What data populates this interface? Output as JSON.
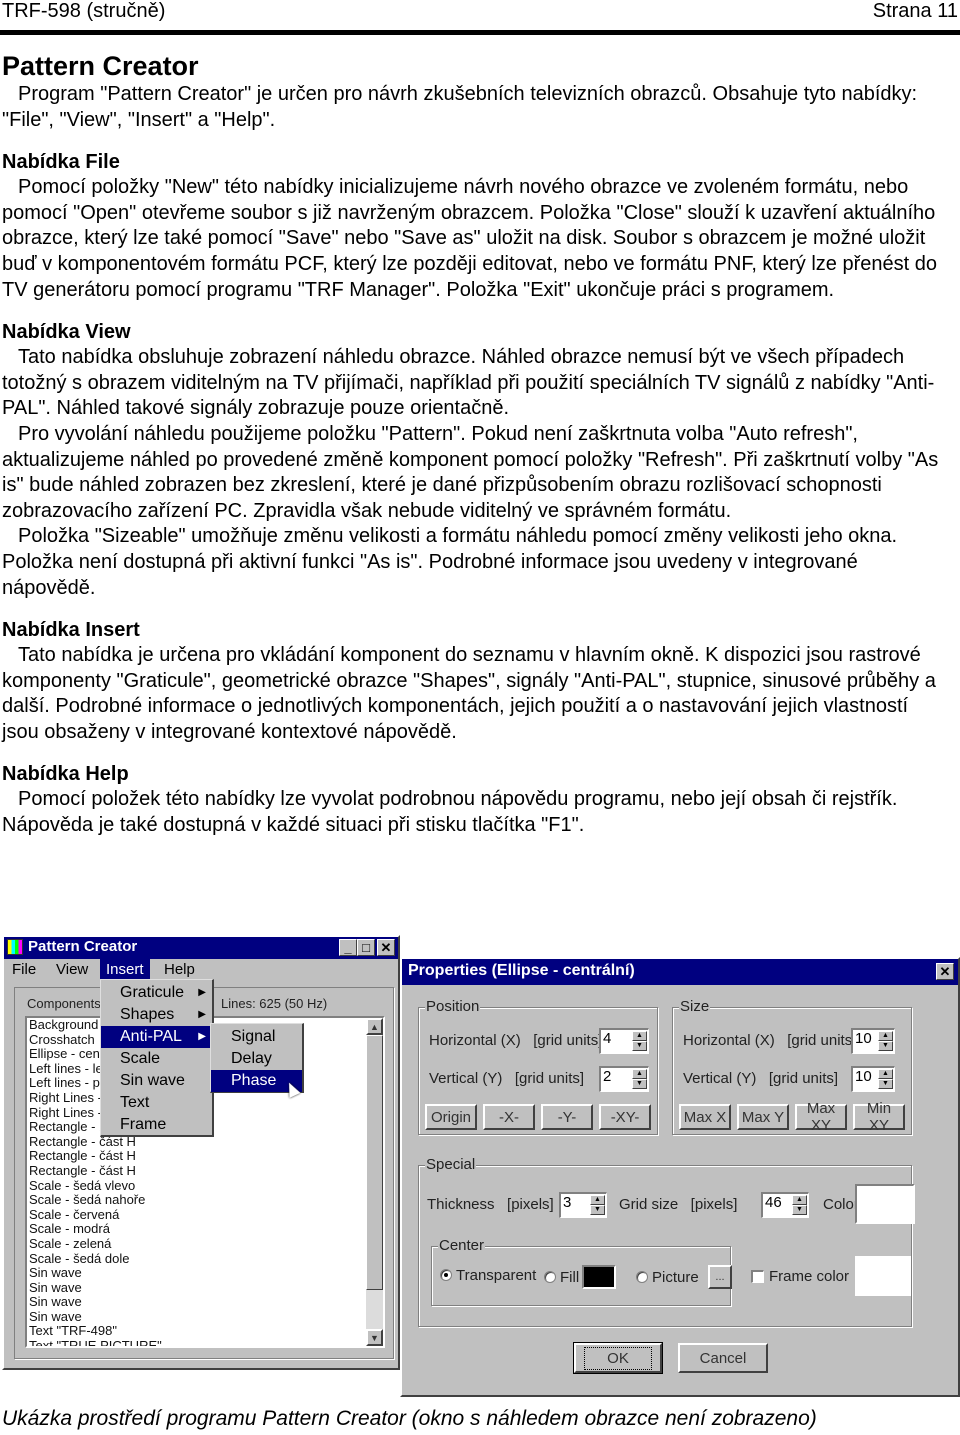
{
  "header": {
    "doc_id": "TRF-598 (stručně)",
    "page": "Strana 11"
  },
  "document": {
    "title": "Pattern Creator",
    "intro": "Program \"Pattern Creator\" je určen pro návrh zkušebních televizních obrazců. Obsahuje tyto nabídky: \"File\", \"View\", \"Insert\" a \"Help\".",
    "sections": [
      {
        "heading": "Nabídka File",
        "paragraphs": [
          "Pomocí položky \"New\" této nabídky inicializujeme návrh nového obrazce ve zvoleném formátu, nebo pomocí \"Open\" otevřeme soubor s již navrženým obrazcem. Položka \"Close\" slouží k uzavření aktuálního obrazce, který lze také pomocí \"Save\" nebo \"Save as\" uložit na disk. Soubor s obrazcem je možné uložit buď v komponentovém formátu PCF, který lze později editovat, nebo ve formátu PNF, který lze přenést do TV generátoru pomocí programu \"TRF Manager\". Položka \"Exit\" ukončuje práci s programem."
        ]
      },
      {
        "heading": "Nabídka View",
        "paragraphs": [
          "Tato nabídka obsluhuje zobrazení náhledu obrazce. Náhled obrazce nemusí být ve všech případech totožný s obrazem viditelným na TV přijímači, například při použití speciálních TV signálů z nabídky \"Anti-PAL\". Náhled takové signály zobrazuje pouze orientačně.",
          "Pro vyvolání náhledu použijeme položku \"Pattern\". Pokud není zaškrtnuta volba \"Auto refresh\", aktualizujeme náhled po provedené změně komponent pomocí položky \"Refresh\". Při zaškrtnutí volby \"As is\" bude náhled zobrazen bez zkreslení, které je dané přizpůsobením obrazu rozlišovací schopnosti zobrazovacího zařízení PC. Zpravidla však nebude viditelný ve správném formátu.",
          "Položka \"Sizeable\" umožňuje změnu velikosti a formátu náhledu pomocí změny velikosti jeho okna. Položka není dostupná při aktivní funkci \"As is\". Podrobné informace jsou uvedeny v integrované nápovědě."
        ]
      },
      {
        "heading": "Nabídka Insert",
        "paragraphs": [
          "Tato nabídka je určena pro vkládání komponent do seznamu v hlavním okně. K dispozici jsou rastrové komponenty \"Graticule\", geometrické obrazce \"Shapes\", signály \"Anti-PAL\", stupnice, sinusové průběhy a další. Podrobné informace o jednotlivých komponentách, jejich použití a o nastavování jejich vlastností jsou obsaženy v integrované kontextové nápovědě."
        ]
      },
      {
        "heading": "Nabídka Help",
        "paragraphs": [
          "Pomocí položek této nabídky lze vyvolat podrobnou nápovědu programu, nebo její obsah či rejstřík. Nápověda je také dostupná v každé situaci při stisku tlačítka \"F1\"."
        ]
      }
    ],
    "caption": "Ukázka prostředí programu Pattern Creator (okno s náhledem obrazce není zobrazeno)"
  },
  "app": {
    "title": "Pattern Creator",
    "menubar": [
      "File",
      "View",
      "Insert",
      "Help"
    ],
    "active_menu": "Insert",
    "components_label": "Components",
    "lines_label": "Lines: 625 (50 Hz)",
    "insert_menu": [
      {
        "label": "Graticule",
        "submenu": true
      },
      {
        "label": "Shapes",
        "submenu": true
      },
      {
        "label": "Anti-PAL",
        "submenu": true,
        "selected": true
      },
      {
        "label": "Scale",
        "submenu": false
      },
      {
        "label": "Sin wave",
        "submenu": false
      },
      {
        "label": "Text",
        "submenu": false
      },
      {
        "label": "Frame",
        "submenu": false
      }
    ],
    "antipal_submenu": [
      {
        "label": "Signal"
      },
      {
        "label": "Delay"
      },
      {
        "label": "Phase",
        "selected": true
      }
    ],
    "components": [
      "Background",
      "Crosshatch",
      "Ellipse - centr",
      "Left lines - lev",
      "Left lines - pre",
      "Right Lines - p",
      "Right Lines - l",
      "Rectangle - b",
      "Rectangle - část H",
      "Rectangle - část H",
      "Rectangle - část H",
      "Scale - šedá vlevo",
      "Scale - šedá nahoře",
      "Scale - červená",
      "Scale - modrá",
      "Scale - zelená",
      "Scale - šedá dole",
      "Sin wave",
      "Sin wave",
      "Sin wave",
      "Sin wave",
      "Text  \"TRF-498\"",
      "Text \"TRUE PICTURE\""
    ]
  },
  "dialog": {
    "title": "Properties (Ellipse - centrální)",
    "position": {
      "label": "Position",
      "horizontal_label": "Horizontal (X)   [grid units]",
      "horizontal_value": "4",
      "vertical_label": "Vertical (Y)   [grid units]",
      "vertical_value": "2",
      "buttons": [
        "Origin",
        "-X-",
        "-Y-",
        "-XY-"
      ]
    },
    "size": {
      "label": "Size",
      "horizontal_label": "Horizontal (X)   [grid units]",
      "horizontal_value": "10",
      "vertical_label": "Vertical (Y)   [grid units]",
      "vertical_value": "10",
      "buttons": [
        "Max X",
        "Max Y",
        "Max XY",
        "Min XY"
      ]
    },
    "special": {
      "label": "Special",
      "thickness_label": "Thickness   [pixels]",
      "thickness_value": "3",
      "grid_label": "Grid size   [pixels]",
      "grid_value": "46",
      "color_label": "Color",
      "color_value": "#ffffff",
      "center_label": "Center",
      "radio_transparent": "Transparent",
      "radio_fill": "Fill",
      "fill_color": "#000000",
      "radio_picture": "Picture",
      "browse_button": "...",
      "selected_center": "Transparent",
      "frame_color_label": "Frame color",
      "frame_color_checked": false,
      "frame_color_value": "#ffffff"
    },
    "ok_label": "OK",
    "cancel_label": "Cancel"
  },
  "colors": {
    "titlebar": "#000080",
    "face": "#c0c0c0"
  }
}
